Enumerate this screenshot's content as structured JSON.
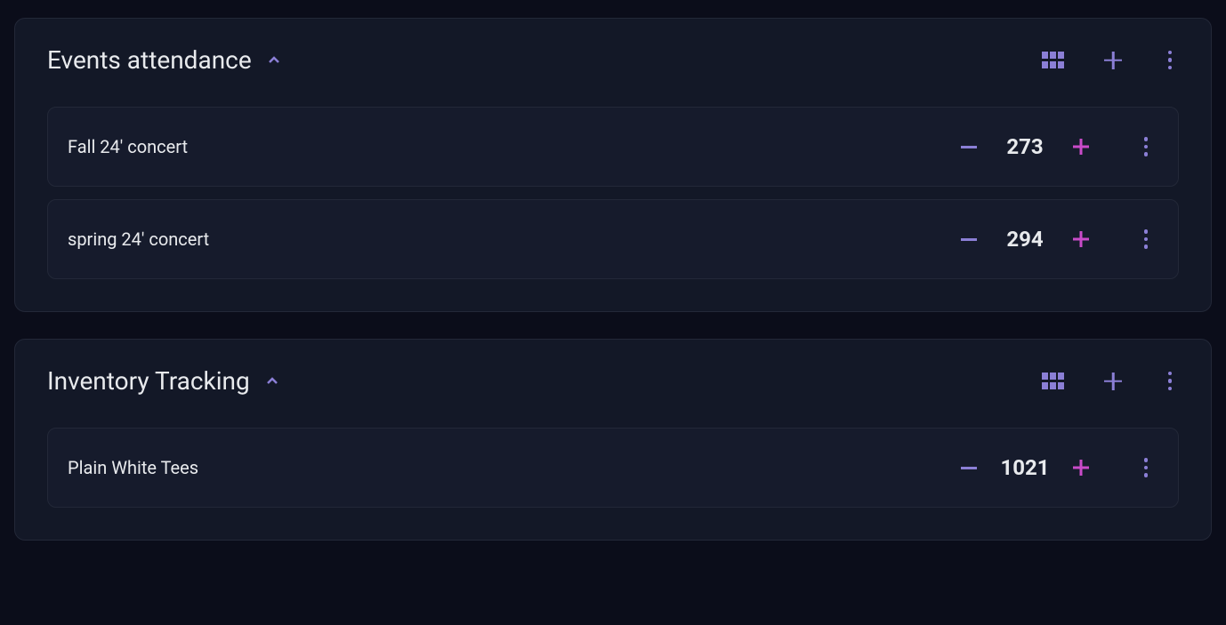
{
  "groups": [
    {
      "title": "Events attendance",
      "items": [
        {
          "name": "Fall 24' concert",
          "value": "273"
        },
        {
          "name": "spring 24' concert",
          "value": "294"
        }
      ]
    },
    {
      "title": "Inventory Tracking",
      "items": [
        {
          "name": "Plain White Tees",
          "value": "1021"
        }
      ]
    }
  ]
}
